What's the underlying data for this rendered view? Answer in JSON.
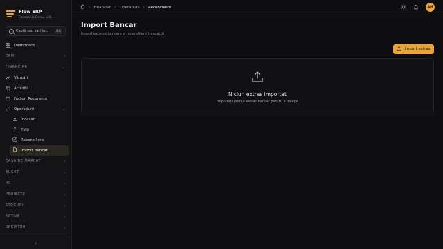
{
  "brand": {
    "title": "Flow ERP",
    "subtitle": "Compania Demo SRL",
    "accent": "#e8a33a"
  },
  "search": {
    "placeholder": "Caută sau sari la...",
    "shortcut": "⌘K"
  },
  "sidebar": {
    "dashboard": "Dashboard",
    "sections": {
      "crm": "CRM",
      "financiar": "FINANCIAR",
      "casa": "CASA DE MARCAT",
      "buget": "BUGET",
      "hr": "HR",
      "proiecte": "PROIECTE",
      "stocuri": "STOCURI",
      "active": "ACTIVE",
      "registru": "REGISTRU"
    },
    "financiar_items": {
      "vanzari": "Vânzări",
      "achizitii": "Achiziții",
      "facturi": "Facturi Recurente",
      "operatiuni": "Operațiuni"
    },
    "operatiuni_items": {
      "incasari": "Încasări",
      "plati": "Plăți",
      "reconciliere": "Reconciliere",
      "import": "Import bancar"
    },
    "collapse_icon": "chevron-left-icon"
  },
  "topbar": {
    "breadcrumb": [
      "Financiar",
      "Operațiuni",
      "Reconciliere"
    ],
    "avatar": "AM"
  },
  "page": {
    "title": "Import Bancar",
    "subtitle": "Import extrase bancare și reconciliere tranzacții",
    "import_button": "Import extras",
    "empty_title": "Niciun extras importat",
    "empty_sub": "Importați primul extras bancar pentru a începe"
  }
}
